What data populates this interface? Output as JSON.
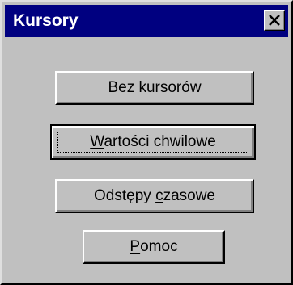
{
  "window": {
    "title": "Kursory"
  },
  "buttons": [
    {
      "id": "bez-kursorow",
      "pre": "",
      "mnemonic": "B",
      "post": "ez kursorów",
      "is_default": false
    },
    {
      "id": "wartosci-chwilowe",
      "pre": "",
      "mnemonic": "W",
      "post": "artości chwilowe",
      "is_default": true
    },
    {
      "id": "odstepy-czasowe",
      "pre": "Odstępy ",
      "mnemonic": "c",
      "post": "zasowe",
      "is_default": false
    },
    {
      "id": "pomoc",
      "pre": "",
      "mnemonic": "P",
      "post": "omoc",
      "is_default": false
    }
  ],
  "colors": {
    "titlebar": "#000080",
    "face": "#c0c0c0",
    "title_text": "#ffffff"
  },
  "icons": {
    "close": "close-icon"
  }
}
